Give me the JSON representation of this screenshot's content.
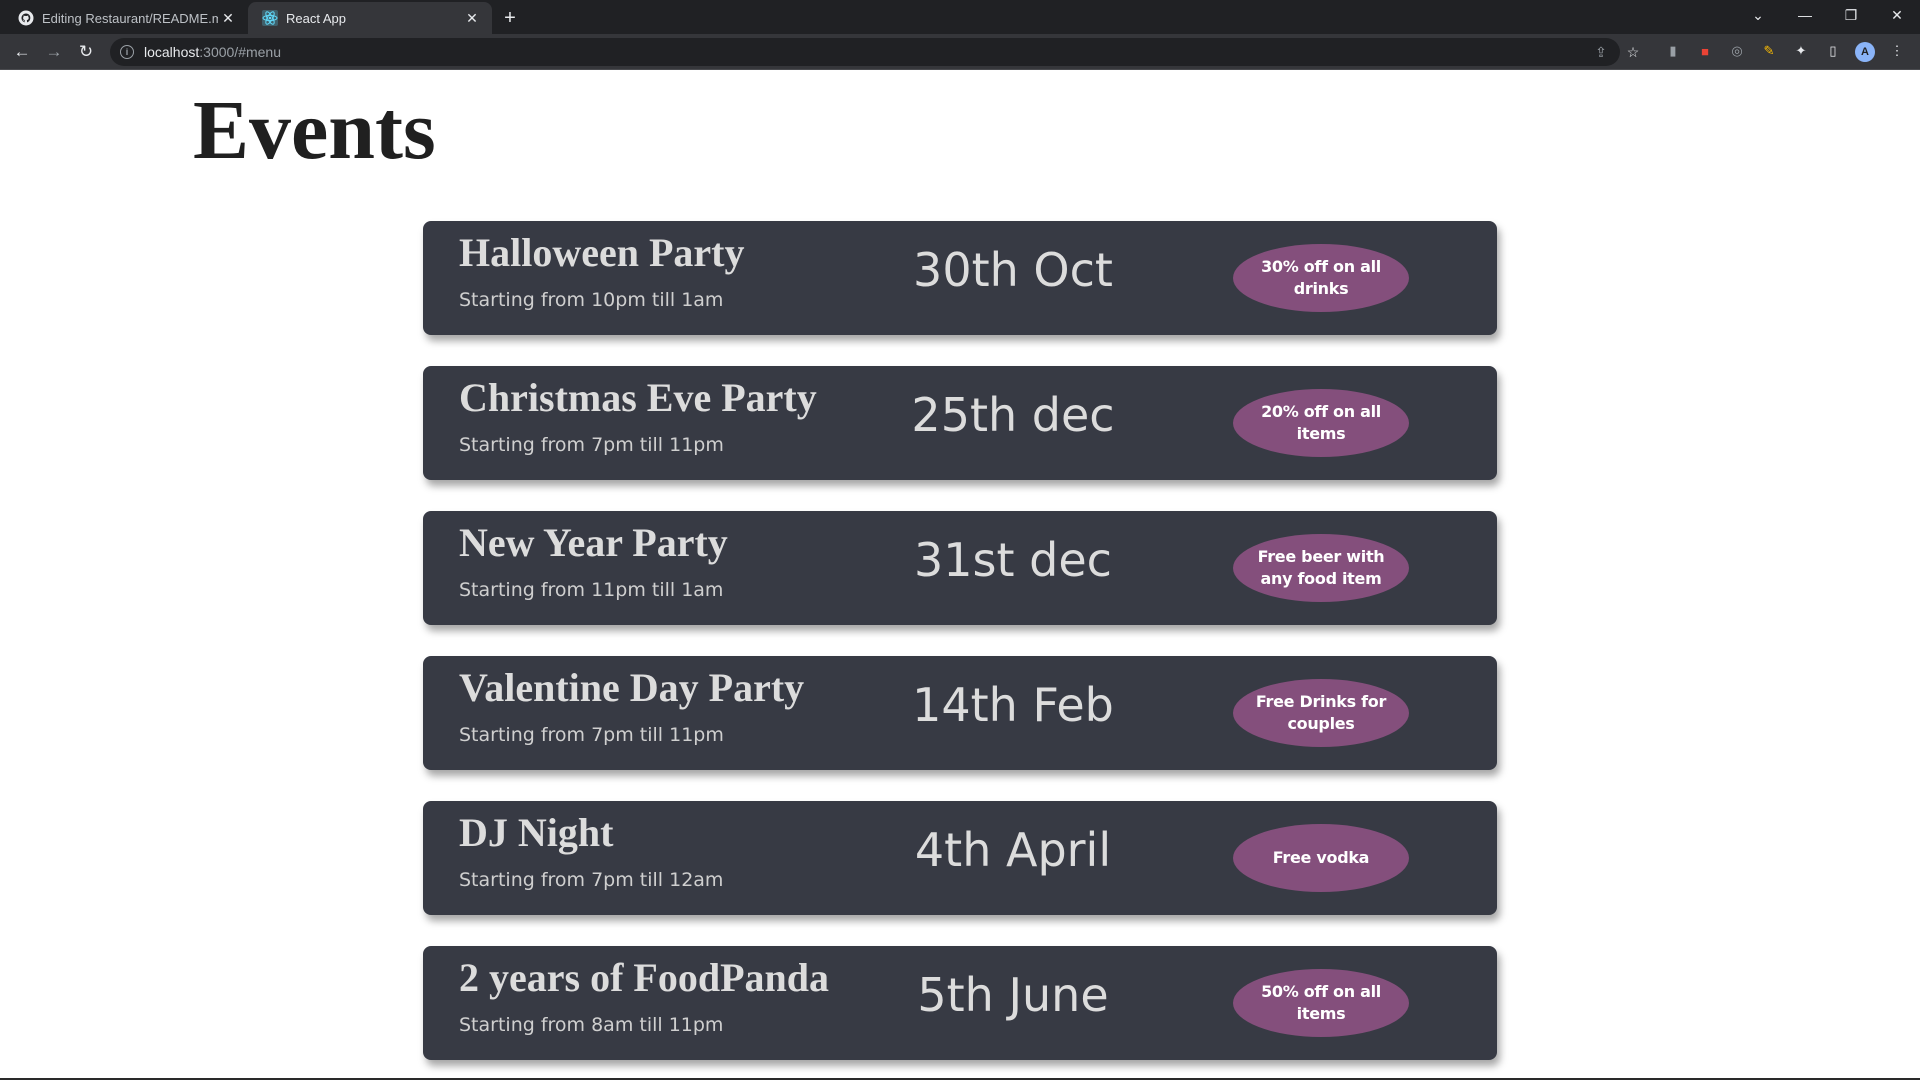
{
  "browser": {
    "tabs": [
      {
        "title": "Editing Restaurant/README.md",
        "icon": "github-icon",
        "active": false
      },
      {
        "title": "React App",
        "icon": "react-icon",
        "active": true
      }
    ],
    "url": {
      "host": "localhost",
      "path": ":3000/#menu"
    }
  },
  "page": {
    "heading": "Events",
    "events": [
      {
        "name": "Halloween Party",
        "time": "Starting from 10pm till 1am",
        "date": "30th Oct",
        "offer": "30% off on all drinks"
      },
      {
        "name": "Christmas Eve Party",
        "time": "Starting from 7pm till 11pm",
        "date": "25th dec",
        "offer": "20% off on all items"
      },
      {
        "name": "New Year Party",
        "time": "Starting from 11pm till 1am",
        "date": "31st dec",
        "offer": "Free beer with any food item"
      },
      {
        "name": "Valentine Day Party",
        "time": "Starting from 7pm till 11pm",
        "date": "14th Feb",
        "offer": "Free Drinks for couples"
      },
      {
        "name": "DJ Night",
        "time": "Starting from 7pm till 12am",
        "date": "4th April",
        "offer": "Free vodka"
      },
      {
        "name": "2 years of FoodPanda",
        "time": "Starting from 8am till 11pm",
        "date": "5th June",
        "offer": "50% off on all items"
      }
    ]
  },
  "colors": {
    "card_bg": "#373a44",
    "offer_bg": "#844f7c",
    "chrome_dark": "#202124",
    "chrome_toolbar": "#35363a"
  }
}
